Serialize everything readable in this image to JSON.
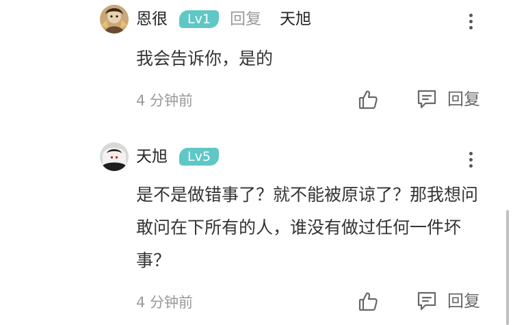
{
  "comments": [
    {
      "username": "恩很",
      "level": "Lv1",
      "reply_word": "回复",
      "reply_to": "天旭",
      "text": "我会告诉你，是的",
      "time": "4 分钟前",
      "reply_label": "回复"
    },
    {
      "username": "天旭",
      "level": "Lv5",
      "text": "是不是做错事了？就不能被原谅了？那我想问敢问在下所有的人，谁没有做过任何一件坏事？",
      "time": "4 分钟前",
      "reply_label": "回复"
    }
  ],
  "icons": {
    "more": "more-vertical-icon",
    "like": "thumbs-up-icon",
    "reply": "comment-icon"
  },
  "colors": {
    "badge": "#5fc7c6",
    "primary_text": "#222222",
    "secondary_text": "#999999"
  }
}
